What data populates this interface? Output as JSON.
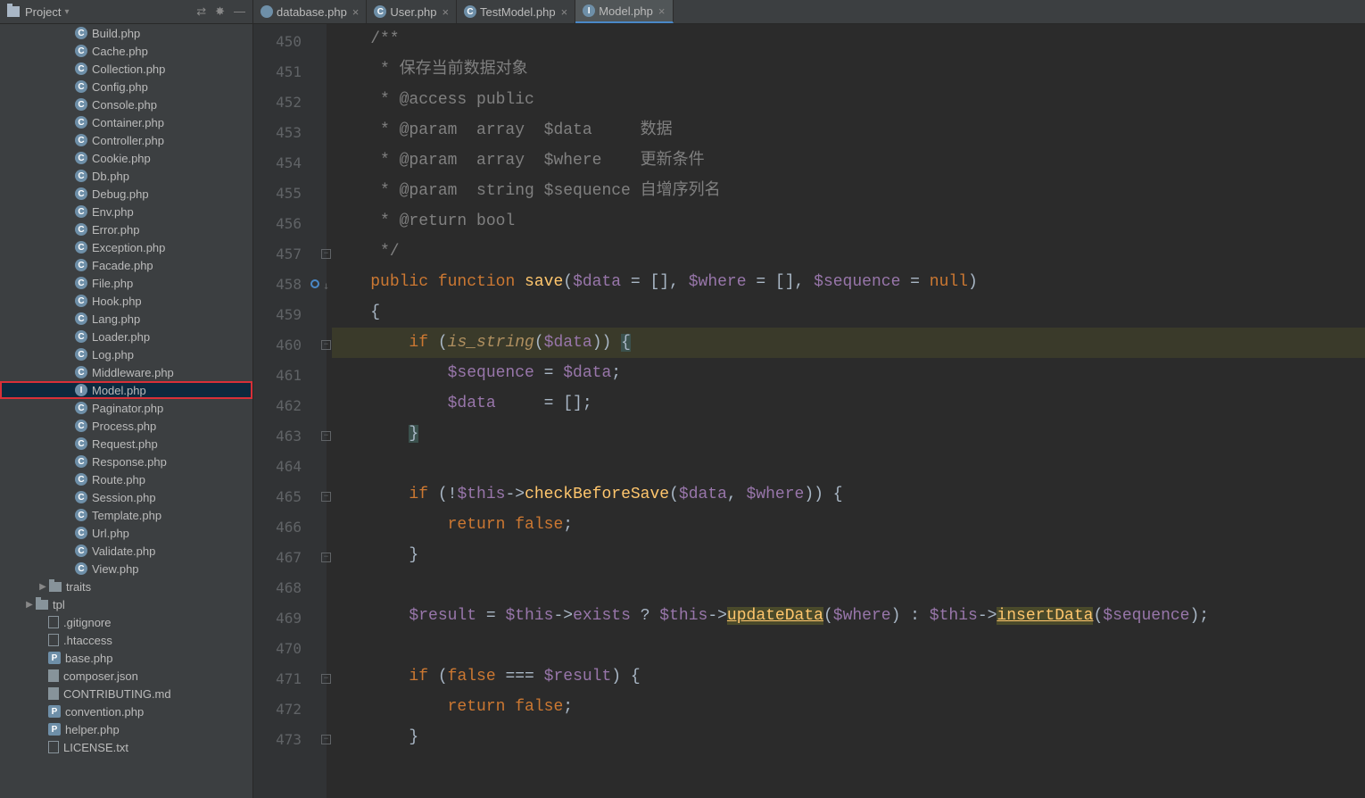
{
  "tool_window": {
    "title": "Project"
  },
  "tabs": [
    {
      "label": "database.php",
      "icon": "db",
      "active": false
    },
    {
      "label": "User.php",
      "icon": "cls",
      "active": false
    },
    {
      "label": "TestModel.php",
      "icon": "cls",
      "active": false
    },
    {
      "label": "Model.php",
      "icon": "iface",
      "active": true
    }
  ],
  "tree": [
    {
      "pad": 84,
      "icon": "c",
      "glyph": "C",
      "label": "Build.php"
    },
    {
      "pad": 84,
      "icon": "c",
      "glyph": "C",
      "label": "Cache.php"
    },
    {
      "pad": 84,
      "icon": "c",
      "glyph": "C",
      "label": "Collection.php"
    },
    {
      "pad": 84,
      "icon": "c",
      "glyph": "C",
      "label": "Config.php"
    },
    {
      "pad": 84,
      "icon": "c",
      "glyph": "C",
      "label": "Console.php"
    },
    {
      "pad": 84,
      "icon": "c",
      "glyph": "C",
      "label": "Container.php"
    },
    {
      "pad": 84,
      "icon": "c",
      "glyph": "C",
      "label": "Controller.php"
    },
    {
      "pad": 84,
      "icon": "c",
      "glyph": "C",
      "label": "Cookie.php"
    },
    {
      "pad": 84,
      "icon": "c",
      "glyph": "C",
      "label": "Db.php"
    },
    {
      "pad": 84,
      "icon": "c",
      "glyph": "C",
      "label": "Debug.php"
    },
    {
      "pad": 84,
      "icon": "c",
      "glyph": "C",
      "label": "Env.php"
    },
    {
      "pad": 84,
      "icon": "c",
      "glyph": "C",
      "label": "Error.php"
    },
    {
      "pad": 84,
      "icon": "c",
      "glyph": "C",
      "label": "Exception.php"
    },
    {
      "pad": 84,
      "icon": "c",
      "glyph": "C",
      "label": "Facade.php"
    },
    {
      "pad": 84,
      "icon": "c",
      "glyph": "C",
      "label": "File.php"
    },
    {
      "pad": 84,
      "icon": "c",
      "glyph": "C",
      "label": "Hook.php"
    },
    {
      "pad": 84,
      "icon": "c",
      "glyph": "C",
      "label": "Lang.php"
    },
    {
      "pad": 84,
      "icon": "c",
      "glyph": "C",
      "label": "Loader.php"
    },
    {
      "pad": 84,
      "icon": "c",
      "glyph": "C",
      "label": "Log.php"
    },
    {
      "pad": 84,
      "icon": "c",
      "glyph": "C",
      "label": "Middleware.php"
    },
    {
      "pad": 84,
      "icon": "i",
      "glyph": "I",
      "label": "Model.php",
      "selected": true,
      "box": true
    },
    {
      "pad": 84,
      "icon": "c",
      "glyph": "C",
      "label": "Paginator.php"
    },
    {
      "pad": 84,
      "icon": "c",
      "glyph": "C",
      "label": "Process.php"
    },
    {
      "pad": 84,
      "icon": "c",
      "glyph": "C",
      "label": "Request.php"
    },
    {
      "pad": 84,
      "icon": "c",
      "glyph": "C",
      "label": "Response.php"
    },
    {
      "pad": 84,
      "icon": "c",
      "glyph": "C",
      "label": "Route.php"
    },
    {
      "pad": 84,
      "icon": "c",
      "glyph": "C",
      "label": "Session.php"
    },
    {
      "pad": 84,
      "icon": "c",
      "glyph": "C",
      "label": "Template.php"
    },
    {
      "pad": 84,
      "icon": "c",
      "glyph": "C",
      "label": "Url.php"
    },
    {
      "pad": 84,
      "icon": "c",
      "glyph": "C",
      "label": "Validate.php"
    },
    {
      "pad": 84,
      "icon": "c",
      "glyph": "C",
      "label": "View.php"
    },
    {
      "pad": 55,
      "caret": "▶",
      "icon": "dir",
      "label": "traits"
    },
    {
      "pad": 40,
      "caret": "▶",
      "icon": "dir",
      "label": "tpl"
    },
    {
      "pad": 54,
      "icon": "text",
      "label": ".gitignore"
    },
    {
      "pad": 54,
      "icon": "text",
      "label": ".htaccess"
    },
    {
      "pad": 54,
      "icon": "php-f",
      "glyph": "P",
      "label": "base.php"
    },
    {
      "pad": 54,
      "icon": "file",
      "label": "composer.json"
    },
    {
      "pad": 54,
      "icon": "file",
      "label": "CONTRIBUTING.md"
    },
    {
      "pad": 54,
      "icon": "php-f",
      "glyph": "P",
      "label": "convention.php"
    },
    {
      "pad": 54,
      "icon": "php-f",
      "glyph": "P",
      "label": "helper.php"
    },
    {
      "pad": 54,
      "icon": "text",
      "label": "LICENSE.txt"
    }
  ],
  "lines": [
    {
      "n": 450,
      "seg": [
        [
          "c-com",
          "    /**"
        ]
      ]
    },
    {
      "n": 451,
      "seg": [
        [
          "c-com",
          "     * 保存当前数据对象"
        ]
      ]
    },
    {
      "n": 452,
      "seg": [
        [
          "c-com",
          "     * @access public"
        ]
      ]
    },
    {
      "n": 453,
      "seg": [
        [
          "c-com",
          "     * @param  array  $data     数据"
        ]
      ]
    },
    {
      "n": 454,
      "seg": [
        [
          "c-com",
          "     * @param  array  $where    更新条件"
        ]
      ]
    },
    {
      "n": 455,
      "seg": [
        [
          "c-com",
          "     * @param  string $sequence 自增序列名"
        ]
      ]
    },
    {
      "n": 456,
      "seg": [
        [
          "c-com",
          "     * @return bool"
        ]
      ]
    },
    {
      "n": 457,
      "seg": [
        [
          "c-com",
          "     */"
        ]
      ],
      "fold_end": true
    },
    {
      "n": 458,
      "seg": [
        [
          "",
          "    "
        ],
        [
          "c-kw",
          "public function "
        ],
        [
          "c-fn",
          "save"
        ],
        [
          "c-op",
          "("
        ],
        [
          "c-var",
          "$data"
        ],
        [
          "c-op",
          " = [], "
        ],
        [
          "c-var",
          "$where"
        ],
        [
          "c-op",
          " = [], "
        ],
        [
          "c-var",
          "$sequence"
        ],
        [
          "c-op",
          " = "
        ],
        [
          "c-kw",
          "null"
        ],
        [
          "c-op",
          ")"
        ]
      ],
      "override": true
    },
    {
      "n": 459,
      "seg": [
        [
          "c-op",
          "    {"
        ]
      ]
    },
    {
      "n": 460,
      "cur": true,
      "seg": [
        [
          "",
          "        "
        ],
        [
          "c-kw",
          "if "
        ],
        [
          "c-op",
          "("
        ],
        [
          "c-call",
          "is_string"
        ],
        [
          "c-op",
          "("
        ],
        [
          "c-var",
          "$data"
        ],
        [
          "c-op",
          ")) "
        ],
        [
          "c-brace-hl",
          "{"
        ]
      ],
      "fold_start": true
    },
    {
      "n": 461,
      "seg": [
        [
          "",
          "            "
        ],
        [
          "c-var",
          "$sequence"
        ],
        [
          "c-op",
          " = "
        ],
        [
          "c-var",
          "$data"
        ],
        [
          "c-op",
          ";"
        ]
      ]
    },
    {
      "n": 462,
      "seg": [
        [
          "",
          "            "
        ],
        [
          "c-var",
          "$data"
        ],
        [
          "c-op",
          "     = [];"
        ]
      ]
    },
    {
      "n": 463,
      "seg": [
        [
          "",
          "        "
        ],
        [
          "c-brace-hl",
          "}"
        ]
      ],
      "fold_end": true
    },
    {
      "n": 464,
      "seg": [
        [
          "",
          ""
        ]
      ]
    },
    {
      "n": 465,
      "seg": [
        [
          "",
          "        "
        ],
        [
          "c-kw",
          "if "
        ],
        [
          "c-op",
          "(!"
        ],
        [
          "c-var",
          "$this"
        ],
        [
          "c-op",
          "->"
        ],
        [
          "c-meth",
          "checkBeforeSave"
        ],
        [
          "c-op",
          "("
        ],
        [
          "c-var",
          "$data"
        ],
        [
          "c-op",
          ", "
        ],
        [
          "c-var",
          "$where"
        ],
        [
          "c-op",
          ")) {"
        ]
      ],
      "fold_start": true
    },
    {
      "n": 466,
      "seg": [
        [
          "",
          "            "
        ],
        [
          "c-kw",
          "return false"
        ],
        [
          "c-op",
          ";"
        ]
      ]
    },
    {
      "n": 467,
      "seg": [
        [
          "",
          "        }"
        ]
      ],
      "fold_end": true
    },
    {
      "n": 468,
      "seg": [
        [
          "",
          ""
        ]
      ]
    },
    {
      "n": 469,
      "seg": [
        [
          "",
          "        "
        ],
        [
          "c-var",
          "$result"
        ],
        [
          "c-op",
          " = "
        ],
        [
          "c-var",
          "$this"
        ],
        [
          "c-op",
          "->"
        ],
        [
          "c-prop",
          "exists"
        ],
        [
          "c-op",
          " ? "
        ],
        [
          "c-var",
          "$this"
        ],
        [
          "c-op",
          "->"
        ],
        [
          "c-meth-hl",
          "updateData"
        ],
        [
          "c-op",
          "("
        ],
        [
          "c-var",
          "$where"
        ],
        [
          "c-op",
          ") : "
        ],
        [
          "c-var",
          "$this"
        ],
        [
          "c-op",
          "->"
        ],
        [
          "c-meth-hl",
          "insertData"
        ],
        [
          "c-op",
          "("
        ],
        [
          "c-var",
          "$sequence"
        ],
        [
          "c-op",
          ");"
        ]
      ]
    },
    {
      "n": 470,
      "seg": [
        [
          "",
          ""
        ]
      ]
    },
    {
      "n": 471,
      "seg": [
        [
          "",
          "        "
        ],
        [
          "c-kw",
          "if "
        ],
        [
          "c-op",
          "("
        ],
        [
          "c-kw",
          "false"
        ],
        [
          "c-op",
          " === "
        ],
        [
          "c-var",
          "$result"
        ],
        [
          "c-op",
          ") {"
        ]
      ],
      "fold_start": true
    },
    {
      "n": 472,
      "seg": [
        [
          "",
          "            "
        ],
        [
          "c-kw",
          "return false"
        ],
        [
          "c-op",
          ";"
        ]
      ]
    },
    {
      "n": 473,
      "seg": [
        [
          "c-op",
          "        }"
        ]
      ],
      "fold_end": true
    }
  ]
}
